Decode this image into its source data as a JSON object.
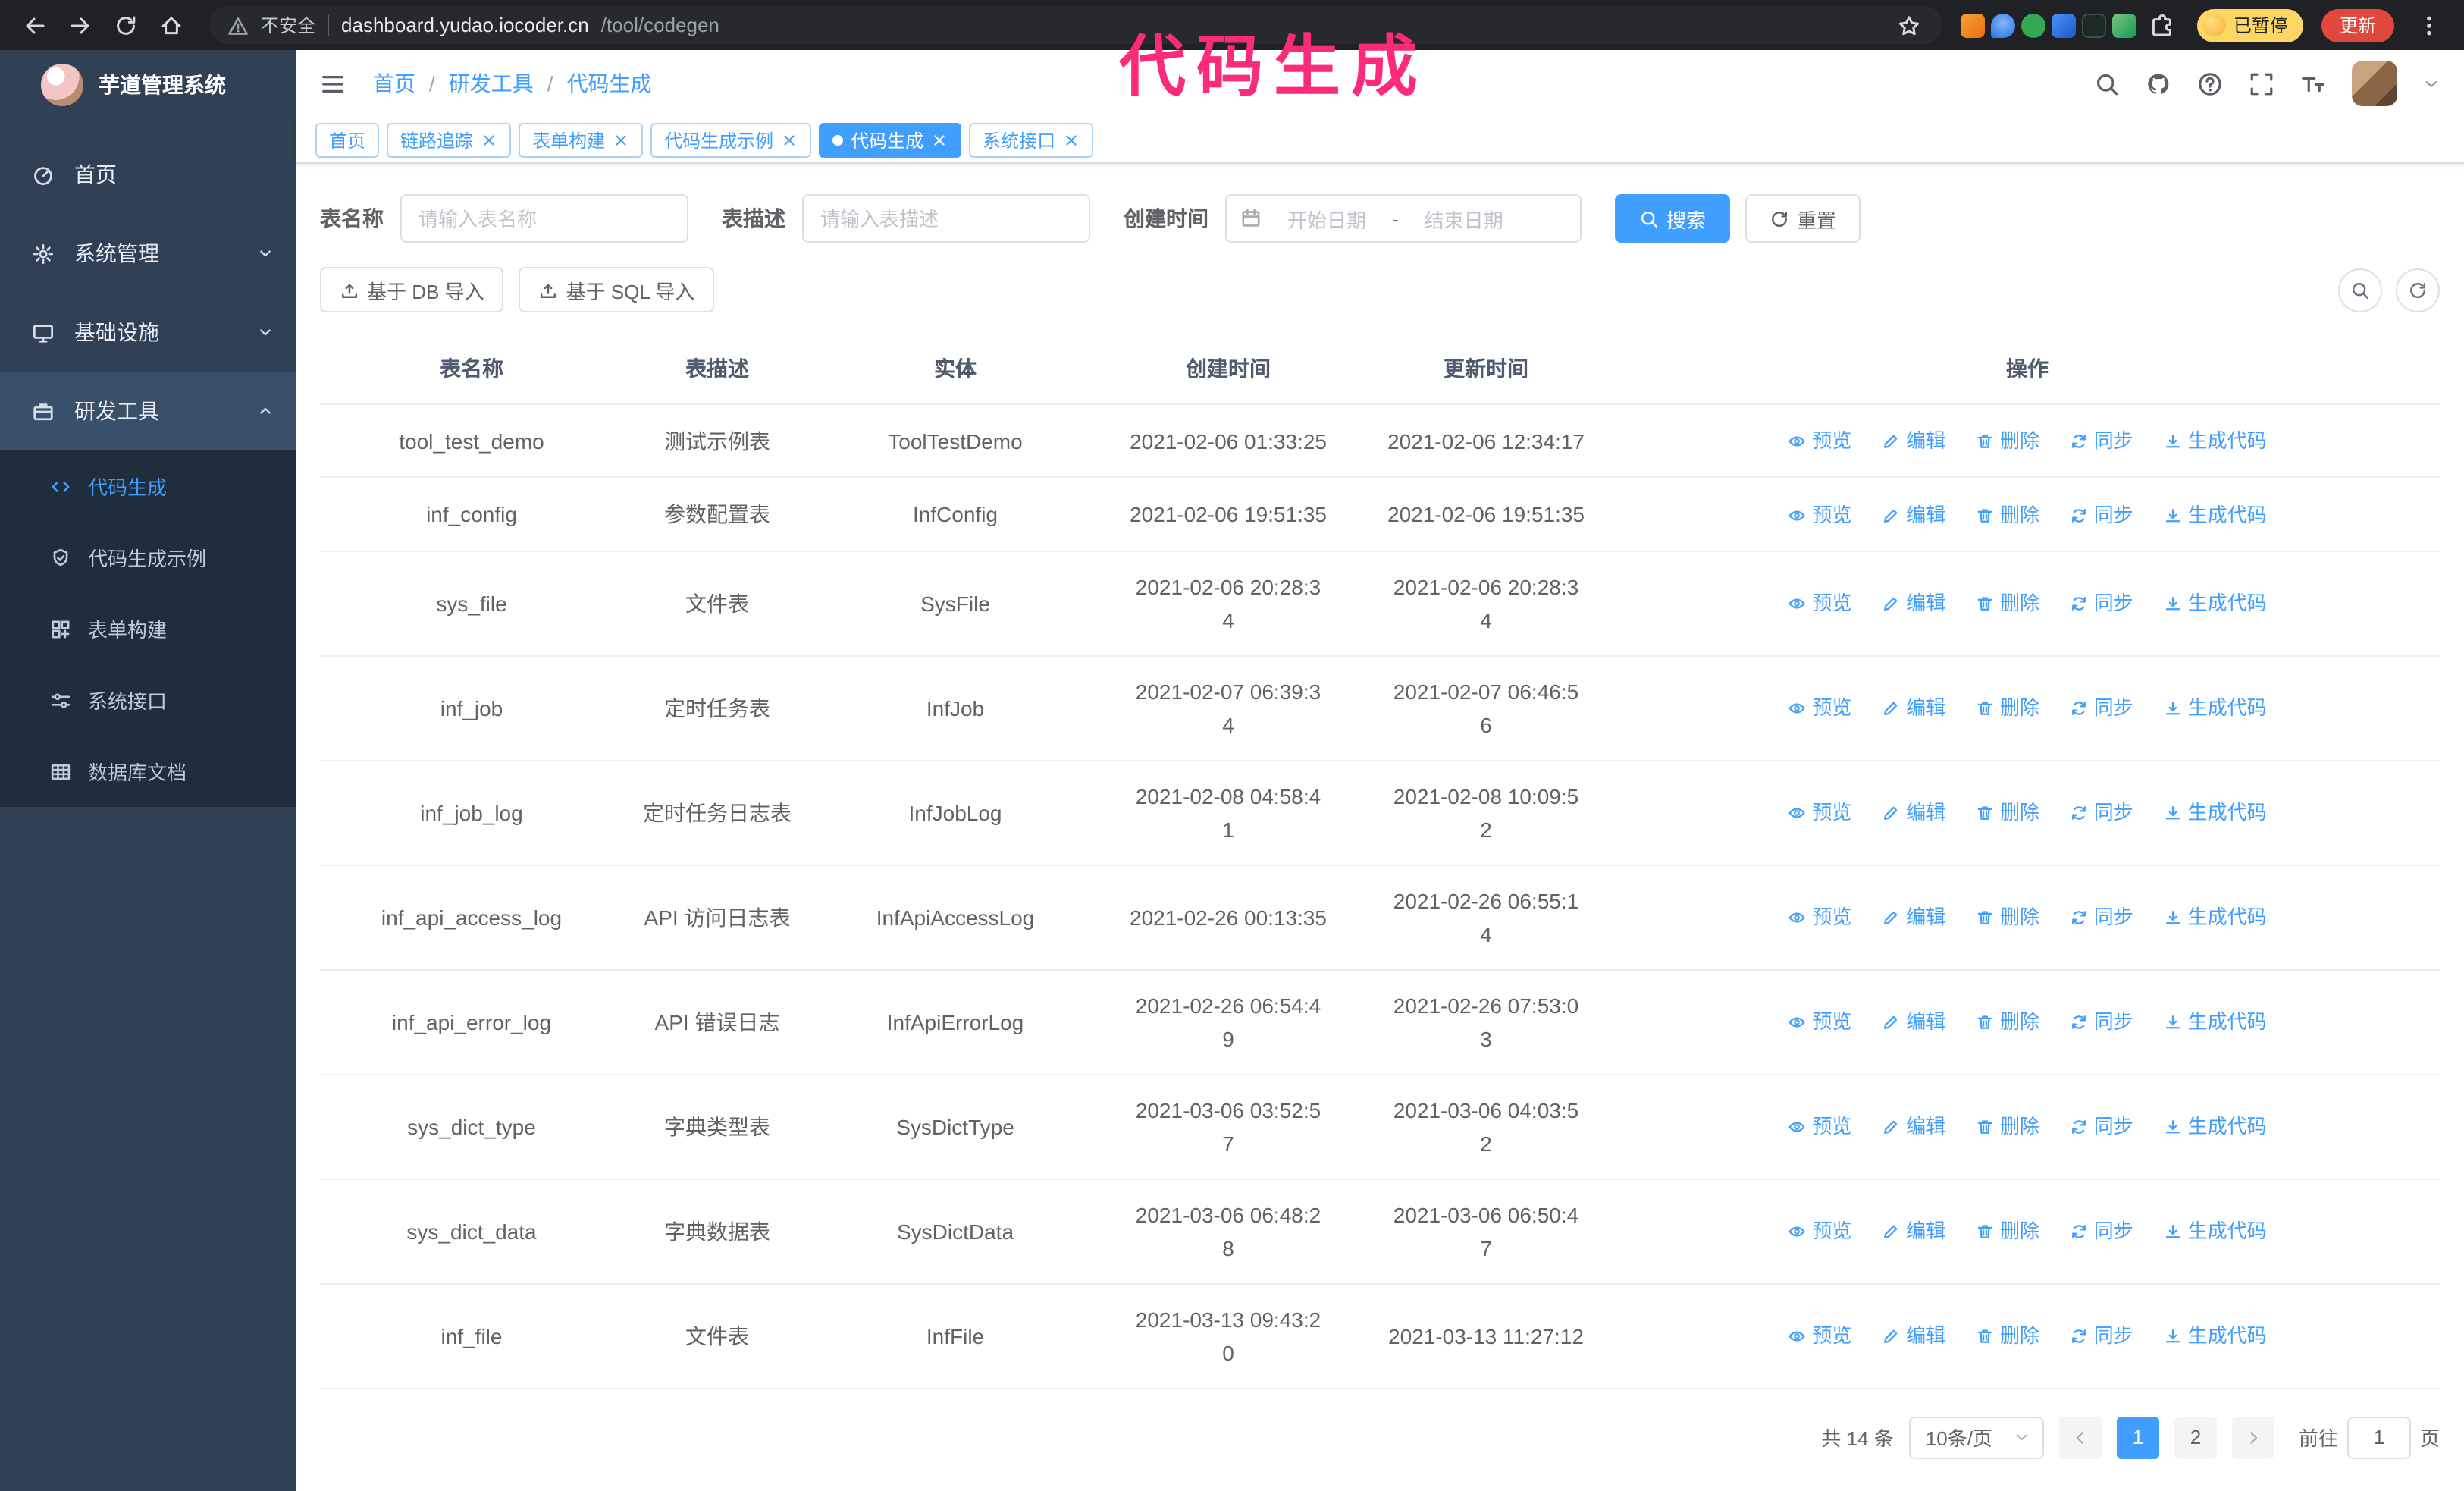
{
  "annotation": {
    "text": "代码生成",
    "color": "#fb2a7a"
  },
  "browser": {
    "insecure_label": "不安全",
    "url_host": "dashboard.yudao.iocoder.cn",
    "url_path": "/tool/codegen",
    "profile_chip": "已暂停",
    "update_button": "更新"
  },
  "sidebar": {
    "title": "芋道管理系统",
    "items": [
      {
        "label": "首页"
      },
      {
        "label": "系统管理"
      },
      {
        "label": "基础设施"
      },
      {
        "label": "研发工具"
      }
    ],
    "submenu": [
      {
        "label": "代码生成"
      },
      {
        "label": "代码生成示例"
      },
      {
        "label": "表单构建"
      },
      {
        "label": "系统接口"
      },
      {
        "label": "数据库文档"
      }
    ]
  },
  "header": {
    "breadcrumb": [
      "首页",
      "研发工具",
      "代码生成"
    ],
    "breadcrumb_separator": "/"
  },
  "tags": [
    {
      "label": "首页"
    },
    {
      "label": "链路追踪"
    },
    {
      "label": "表单构建"
    },
    {
      "label": "代码生成示例"
    },
    {
      "label": "代码生成"
    },
    {
      "label": "系统接口"
    }
  ],
  "filters": {
    "name_label": "表名称",
    "name_placeholder": "请输入表名称",
    "desc_label": "表描述",
    "desc_placeholder": "请输入表描述",
    "time_label": "创建时间",
    "start_placeholder": "开始日期",
    "range_separator": "-",
    "end_placeholder": "结束日期",
    "search_label": "搜索",
    "reset_label": "重置"
  },
  "toolbar": {
    "import_db_label": "基于 DB 导入",
    "import_sql_label": "基于 SQL 导入"
  },
  "table": {
    "columns": [
      "表名称",
      "表描述",
      "实体",
      "创建时间",
      "更新时间",
      "操作"
    ],
    "actions": [
      "预览",
      "编辑",
      "删除",
      "同步",
      "生成代码"
    ],
    "rows": [
      {
        "name": "tool_test_demo",
        "desc": "测试示例表",
        "entity": "ToolTestDemo",
        "created_lines": [
          "2021-02-06 01:33:25"
        ],
        "updated_lines": [
          "2021-02-06 12:34:17"
        ]
      },
      {
        "name": "inf_config",
        "desc": "参数配置表",
        "entity": "InfConfig",
        "created_lines": [
          "2021-02-06 19:51:35"
        ],
        "updated_lines": [
          "2021-02-06 19:51:35"
        ]
      },
      {
        "name": "sys_file",
        "desc": "文件表",
        "entity": "SysFile",
        "created_lines": [
          "2021-02-06 20:28:3",
          "4"
        ],
        "updated_lines": [
          "2021-02-06 20:28:3",
          "4"
        ]
      },
      {
        "name": "inf_job",
        "desc": "定时任务表",
        "entity": "InfJob",
        "created_lines": [
          "2021-02-07 06:39:3",
          "4"
        ],
        "updated_lines": [
          "2021-02-07 06:46:5",
          "6"
        ]
      },
      {
        "name": "inf_job_log",
        "desc": "定时任务日志表",
        "entity": "InfJobLog",
        "created_lines": [
          "2021-02-08 04:58:4",
          "1"
        ],
        "updated_lines": [
          "2021-02-08 10:09:5",
          "2"
        ]
      },
      {
        "name": "inf_api_access_log",
        "desc": "API 访问日志表",
        "entity": "InfApiAccessLog",
        "created_lines": [
          "2021-02-26 00:13:35"
        ],
        "updated_lines": [
          "2021-02-26 06:55:1",
          "4"
        ]
      },
      {
        "name": "inf_api_error_log",
        "desc": "API 错误日志",
        "entity": "InfApiErrorLog",
        "created_lines": [
          "2021-02-26 06:54:4",
          "9"
        ],
        "updated_lines": [
          "2021-02-26 07:53:0",
          "3"
        ]
      },
      {
        "name": "sys_dict_type",
        "desc": "字典类型表",
        "entity": "SysDictType",
        "created_lines": [
          "2021-03-06 03:52:5",
          "7"
        ],
        "updated_lines": [
          "2021-03-06 04:03:5",
          "2"
        ]
      },
      {
        "name": "sys_dict_data",
        "desc": "字典数据表",
        "entity": "SysDictData",
        "created_lines": [
          "2021-03-06 06:48:2",
          "8"
        ],
        "updated_lines": [
          "2021-03-06 06:50:4",
          "7"
        ]
      },
      {
        "name": "inf_file",
        "desc": "文件表",
        "entity": "InfFile",
        "created_lines": [
          "2021-03-13 09:43:2",
          "0"
        ],
        "updated_lines": [
          "2021-03-13 11:27:12"
        ]
      }
    ]
  },
  "pagination": {
    "total": "共 14 条",
    "page_size": "10条/页",
    "pages": [
      "1",
      "2"
    ],
    "active_page": "1",
    "goto_label": "前往",
    "goto_value": "1",
    "unit_label": "页"
  },
  "colors": {
    "accent": "#409eff",
    "sidebar_bg": "#304156",
    "submenu_bg": "#1f2d3d"
  }
}
